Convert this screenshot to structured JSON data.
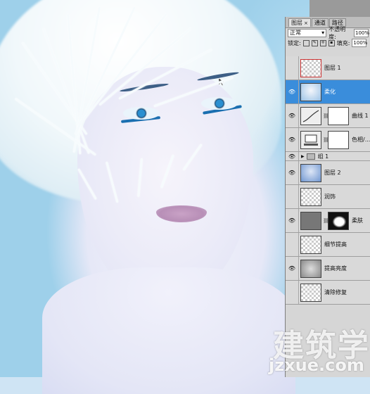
{
  "panel": {
    "tabs": [
      {
        "label": "图层",
        "close": "×"
      },
      {
        "label": "通道"
      },
      {
        "label": "路径"
      }
    ],
    "blend_mode": "正常",
    "opacity_label": "不透明度:",
    "opacity_value": "100%",
    "lock_label": "锁定:",
    "fill_label": "填充:",
    "fill_value": "100%",
    "layers": [
      {
        "name": "图层 1"
      },
      {
        "name": "柔化"
      },
      {
        "name": "曲线 1"
      },
      {
        "name": "色相/..."
      },
      {
        "name": "组 1"
      },
      {
        "name": "图层 2"
      },
      {
        "name": "润饰"
      },
      {
        "name": "柔肤"
      },
      {
        "name": "细节提高"
      },
      {
        "name": "提高亮度"
      },
      {
        "name": "清除修复"
      }
    ]
  },
  "watermark": {
    "text": "建筑学",
    "subtext": "jzxue.com"
  },
  "colors": {
    "selected_layer": "#3a8ddb",
    "panel_bg": "#d6d6d6"
  }
}
